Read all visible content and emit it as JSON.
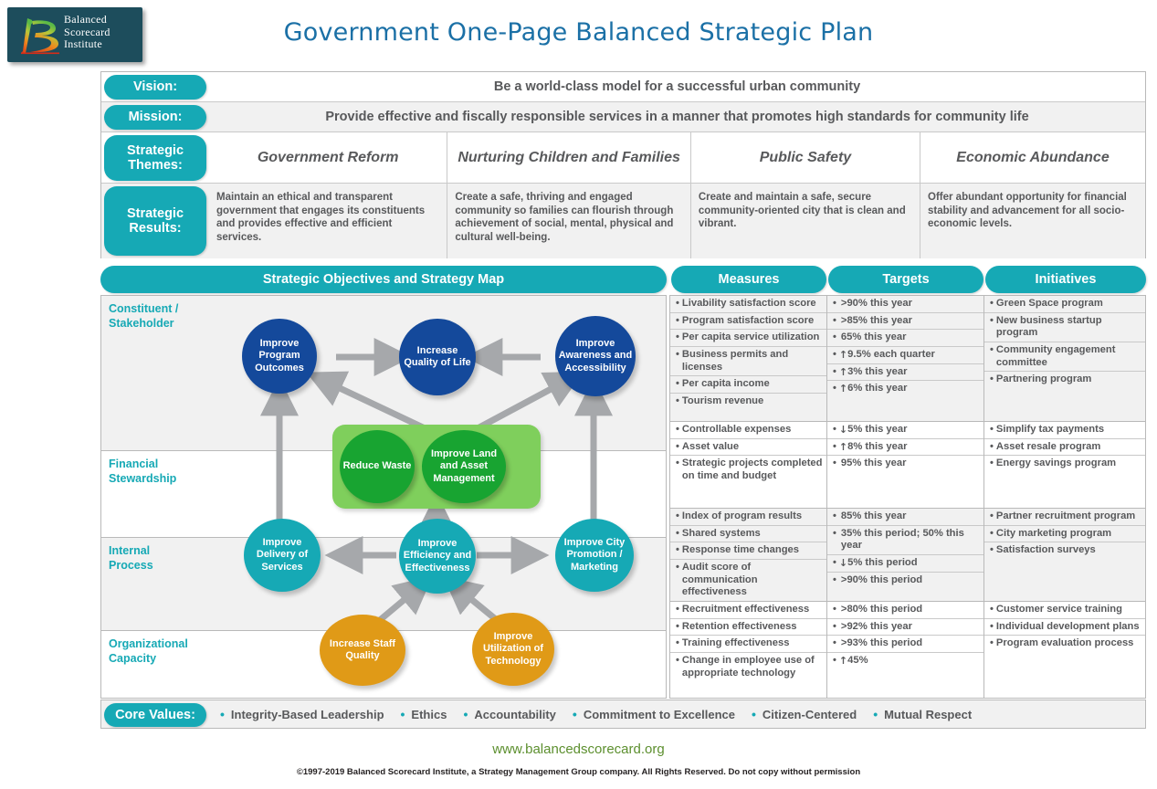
{
  "logo": {
    "line1": "Balanced",
    "line2": "Scorecard",
    "line3": "Institute"
  },
  "title": "Government One-Page Balanced Strategic Plan",
  "colors": {
    "teal": "#16a9b5",
    "title_blue": "#1b70a6",
    "node_blue": "#14499b",
    "node_green": "#18a431",
    "node_orange": "#e09a17",
    "green_box": "#7fcf5c",
    "url_green": "#5c8f2e"
  },
  "top": {
    "vision_label": "Vision:",
    "vision_text": "Be a world-class model for a successful urban community",
    "mission_label": "Mission:",
    "mission_text": "Provide effective and fiscally responsible services in a manner that promotes high standards for community life",
    "themes_label": "Strategic Themes:",
    "themes": [
      "Government Reform",
      "Nurturing Children and Families",
      "Public Safety",
      "Economic Abundance"
    ],
    "results_label": "Strategic Results:",
    "results": [
      "Maintain an ethical and transparent government that engages its constituents and provides effective and efficient services.",
      "Create a safe, thriving and engaged community so families can flourish through achievement of social, mental, physical and cultural well-being.",
      "Create and maintain a safe, secure community-oriented city that is clean and vibrant.",
      "Offer abundant opportunity for financial stability and advancement for all socio-economic levels."
    ]
  },
  "headers": {
    "map": "Strategic Objectives and Strategy Map",
    "measures": "Measures",
    "targets": "Targets",
    "initiatives": "Initiatives"
  },
  "perspectives": [
    {
      "label": "Constituent / Stakeholder"
    },
    {
      "label": "Financial Stewardship"
    },
    {
      "label": "Internal Process"
    },
    {
      "label": "Organizational Capacity"
    }
  ],
  "nodes": [
    {
      "id": "n1",
      "label": "Improve Program Outcomes",
      "color": "blue"
    },
    {
      "id": "n2",
      "label": "Increase Quality of Life",
      "color": "blue"
    },
    {
      "id": "n3",
      "label": "Improve Awareness and Accessibility",
      "color": "blue"
    },
    {
      "id": "n4",
      "label": "Reduce Waste",
      "color": "green"
    },
    {
      "id": "n5",
      "label": "Improve Land and Asset Management",
      "color": "green"
    },
    {
      "id": "n6",
      "label": "Improve Delivery of Services",
      "color": "teal"
    },
    {
      "id": "n7",
      "label": "Improve Efficiency and Effectiveness",
      "color": "teal"
    },
    {
      "id": "n8",
      "label": "Improve City Promotion / Marketing",
      "color": "teal"
    },
    {
      "id": "n9",
      "label": "Increase Staff Quality",
      "color": "orange"
    },
    {
      "id": "n10",
      "label": "Improve Utilization of Technology",
      "color": "orange"
    }
  ],
  "rows": [
    {
      "measures": [
        "Livability satisfaction score",
        "Program satisfaction score",
        "Per capita service utilization",
        "Business permits and licenses",
        "Per capita income",
        "Tourism revenue"
      ],
      "targets": [
        {
          "arrow": "",
          "text": ">90% this year"
        },
        {
          "arrow": "",
          "text": ">85% this year"
        },
        {
          "arrow": "",
          "text": "65% this year"
        },
        {
          "arrow": "↑",
          "text": "9.5% each quarter"
        },
        {
          "arrow": "↑",
          "text": "3% this year"
        },
        {
          "arrow": "↑",
          "text": "6% this year"
        }
      ],
      "initiatives": [
        "Green Space program",
        "New business startup program",
        "Community engagement committee",
        "Partnering program"
      ]
    },
    {
      "measures": [
        "Controllable expenses",
        "Asset value",
        "Strategic projects completed on time and budget"
      ],
      "targets": [
        {
          "arrow": "↓",
          "text": "5% this year"
        },
        {
          "arrow": "↑",
          "text": "8% this year"
        },
        {
          "arrow": "",
          "text": "95% this year"
        }
      ],
      "initiatives": [
        "Simplify tax payments",
        "Asset resale program",
        "Energy savings program"
      ]
    },
    {
      "measures": [
        "Index of program results",
        "Shared systems",
        "Response time changes",
        "Audit score of communication effectiveness"
      ],
      "targets": [
        {
          "arrow": "",
          "text": "85% this year"
        },
        {
          "arrow": "",
          "text": "35% this period; 50% this year"
        },
        {
          "arrow": "↓",
          "text": "5% this period"
        },
        {
          "arrow": "",
          "text": ">90% this period"
        }
      ],
      "initiatives": [
        "Partner recruitment program",
        "City marketing program",
        "Satisfaction surveys"
      ]
    },
    {
      "measures": [
        "Recruitment effectiveness",
        "Retention effectiveness",
        "Training effectiveness",
        "Change in employee use of appropriate technology"
      ],
      "targets": [
        {
          "arrow": "",
          "text": ">80% this period"
        },
        {
          "arrow": "",
          "text": ">92% this year"
        },
        {
          "arrow": "",
          "text": ">93% this period"
        },
        {
          "arrow": "↑",
          "text": "45%"
        }
      ],
      "initiatives": [
        "Customer service training",
        "Individual development plans",
        "Program evaluation process"
      ]
    }
  ],
  "core_values": {
    "label": "Core Values:",
    "items": [
      "Integrity-Based Leadership",
      "Ethics",
      "Accountability",
      "Commitment to Excellence",
      "Citizen-Centered",
      "Mutual Respect"
    ]
  },
  "footer": {
    "url": "www.balancedscorecard.org",
    "copyright": "©1997-2019 Balanced Scorecard Institute, a Strategy Management Group company. All Rights Reserved. Do not copy without permission"
  }
}
